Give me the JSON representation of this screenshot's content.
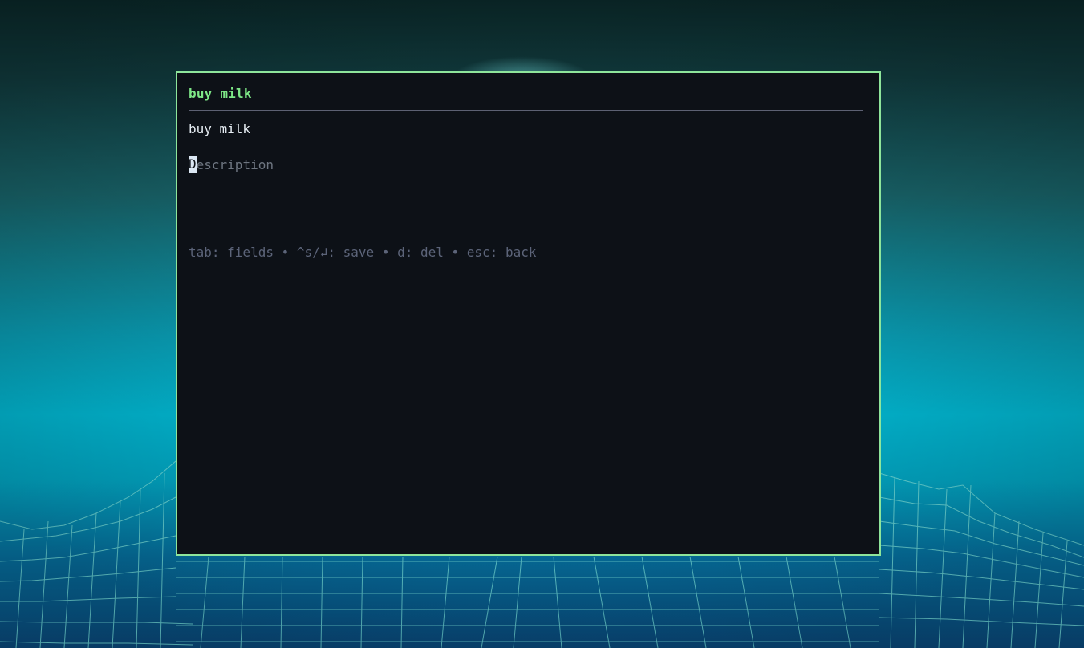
{
  "window": {
    "title": "buy milk",
    "border_color": "#8ee59b",
    "background_color": "#0d1117"
  },
  "form": {
    "title_value": "buy milk",
    "description_placeholder": "Description",
    "description_cursor_char": "D",
    "description_rest": "escription"
  },
  "help": {
    "text": "tab: fields • ^s/↲: save • d: del • esc: back"
  },
  "colors": {
    "accent": "#7ee787",
    "text": "#e6edf3",
    "muted": "#6e7681",
    "help": "#5c6479"
  }
}
